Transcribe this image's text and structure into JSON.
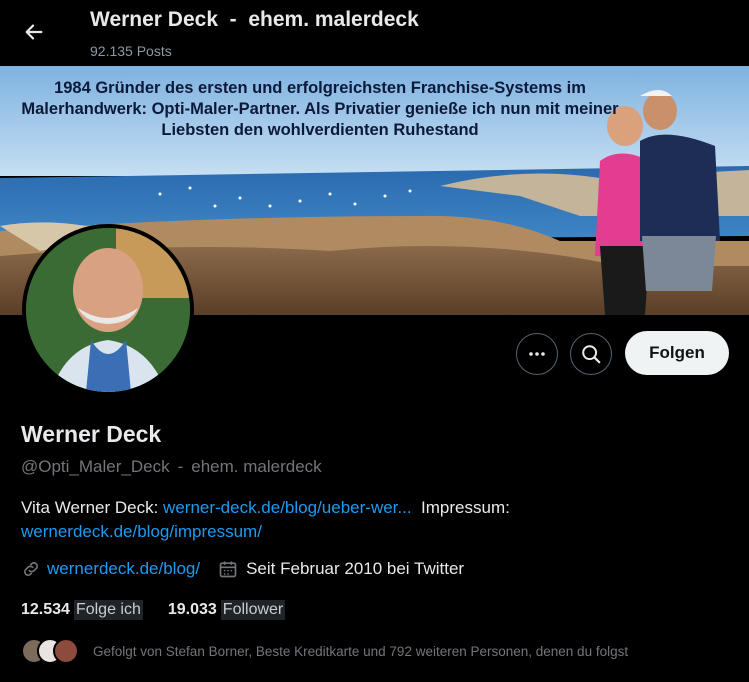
{
  "header": {
    "title": "Werner Deck  -  ehem. malerdeck",
    "posts": "92.135 Posts"
  },
  "banner": {
    "text": "1984 Gründer des ersten und erfolgreichsten Franchise-Systems im Malerhandwerk: Opti-Maler-Partner. Als Privatier genieße ich nun mit meiner Liebsten den wohlverdienten Ruhestand"
  },
  "actions": {
    "more_icon": "more-icon",
    "search_icon": "search-icon",
    "follow_label": "Folgen"
  },
  "profile": {
    "name": "Werner Deck",
    "handle": "@Opti_Maler_Deck",
    "separator": "-",
    "subtitle": "ehem. malerdeck",
    "bio_prefix": "Vita Werner Deck:",
    "bio_link1": "werner-deck.de/blog/ueber-wer...",
    "bio_mid": "Impressum:",
    "bio_link2": "wernerdeck.de/blog/impressum/",
    "website": "wernerdeck.de/blog/",
    "joined": "Seit Februar 2010 bei Twitter"
  },
  "stats": {
    "following_count": "12.534",
    "following_label": "Folge ich",
    "followers_count": "19.033",
    "followers_label": "Follower"
  },
  "followed_by": {
    "text": "Gefolgt von Stefan Borner, Beste Kreditkarte und 792 weiteren Personen, denen du folgst"
  },
  "colors": {
    "background": "#000000",
    "link": "#1d9bf0",
    "muted": "#71767b",
    "follow_button": "#eff3f4"
  }
}
